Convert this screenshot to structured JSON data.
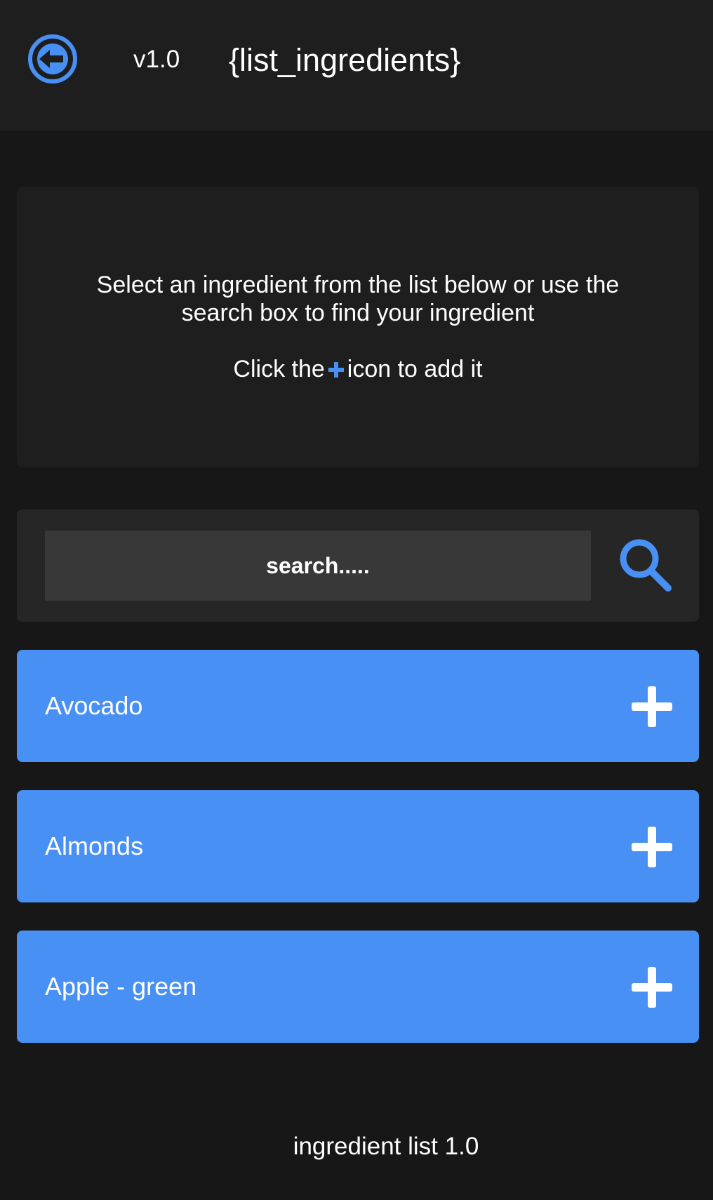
{
  "header": {
    "back_icon": "arrow-left-circle-icon",
    "version": "v1.0",
    "title": "{list_ingredients}"
  },
  "info": {
    "line1": "Select an ingredient from the list below or use the",
    "line2": "search box to find your ingredient",
    "line3_before": "Click the",
    "line3_icon": "plus-icon",
    "line3_after": "icon to add it"
  },
  "search": {
    "placeholder": "search.....",
    "value": "",
    "icon": "search-icon"
  },
  "ingredients": [
    {
      "label": "Avocado",
      "action_icon": "plus-icon"
    },
    {
      "label": "Almonds",
      "action_icon": "plus-icon"
    },
    {
      "label": "Apple - green",
      "action_icon": "plus-icon"
    }
  ],
  "footer": {
    "text": "ingredient list 1.0"
  },
  "colors": {
    "background": "#171717",
    "panel": "#1e1e1e",
    "search_panel": "#262626",
    "search_input": "#393838",
    "accent": "#4990f5",
    "text": "#ffffff"
  }
}
